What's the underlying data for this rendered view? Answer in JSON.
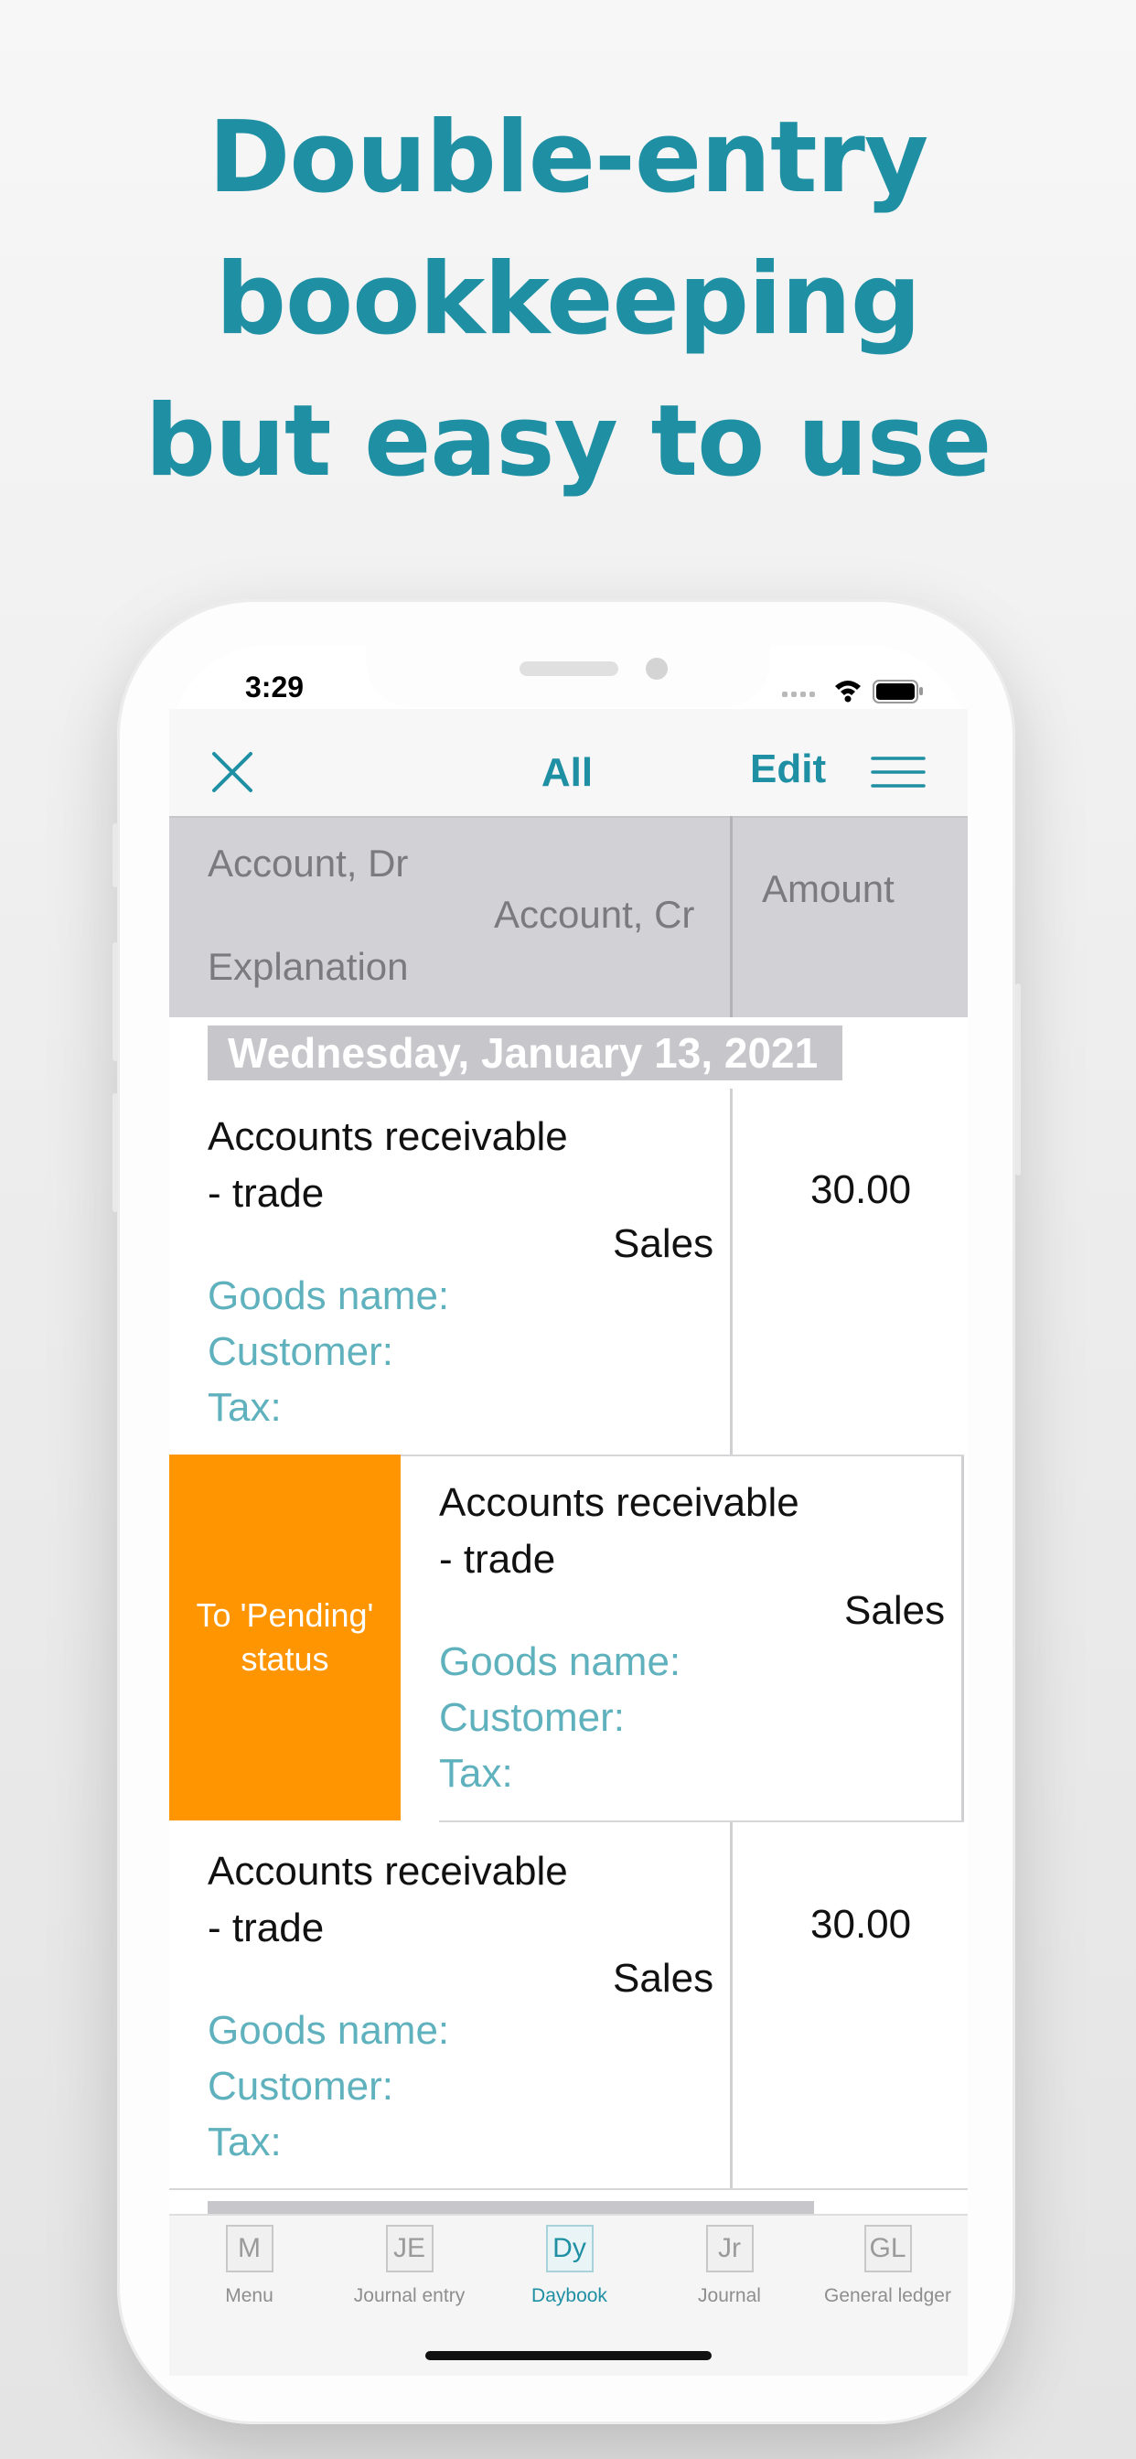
{
  "headline": {
    "line1": "Double-entry",
    "line2": "bookkeeping",
    "line3": "but easy to use"
  },
  "status_bar": {
    "time": "3:29"
  },
  "nav": {
    "title": "All",
    "edit_label": "Edit"
  },
  "column_header": {
    "account_dr": "Account, Dr",
    "account_cr": "Account, Cr",
    "explanation": "Explanation",
    "amount": "Amount"
  },
  "date_header": "Wednesday, January 13, 2021",
  "entries": [
    {
      "debit": "Accounts receivable",
      "debit_cont": "- trade",
      "credit": "Sales",
      "amount": "30.00",
      "goods": "Goods name:",
      "customer": "Customer:",
      "tax": "Tax:"
    },
    {
      "debit": "Accounts receivable",
      "debit_cont": "- trade",
      "credit": "Sales",
      "amount": "",
      "goods": "Goods name:",
      "customer": "Customer:",
      "tax": "Tax:",
      "swipe_action": "To 'Pending' status"
    },
    {
      "debit": "Accounts receivable",
      "debit_cont": "- trade",
      "credit": "Sales",
      "amount": "30.00",
      "goods": "Goods name:",
      "customer": "Customer:",
      "tax": "Tax:"
    }
  ],
  "tabs": [
    {
      "abbr": "M",
      "label": "Menu"
    },
    {
      "abbr": "JE",
      "label": "Journal entry"
    },
    {
      "abbr": "Dy",
      "label": "Daybook"
    },
    {
      "abbr": "Jr",
      "label": "Journal"
    },
    {
      "abbr": "GL",
      "label": "General ledger"
    }
  ],
  "colors": {
    "accent": "#1f8fa3",
    "meta": "#5fb2bd",
    "pending": "#ff9500",
    "header_bg": "#d2d2d6"
  }
}
